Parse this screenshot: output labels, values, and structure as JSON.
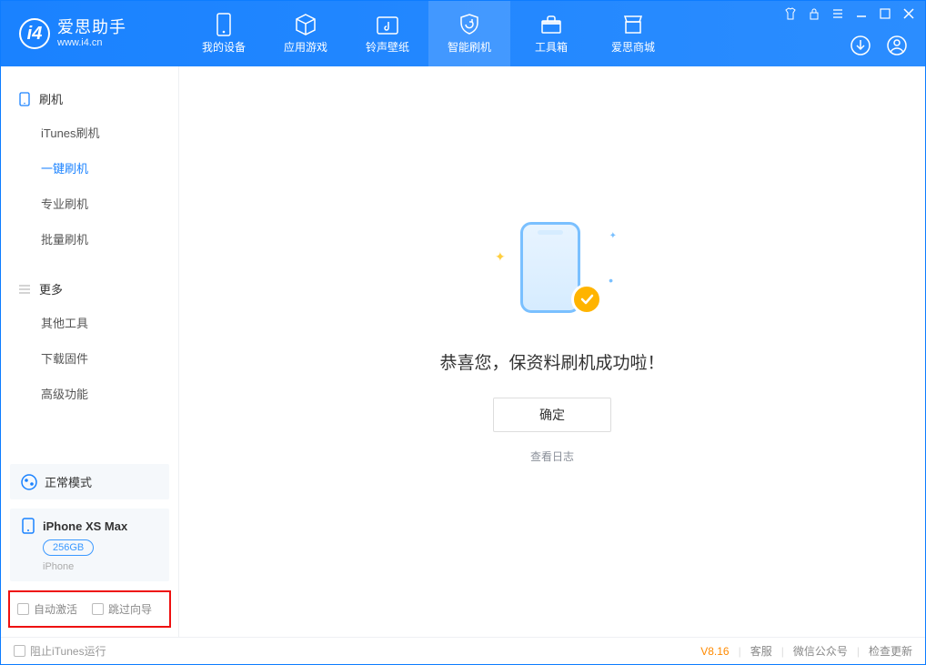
{
  "app": {
    "name": "爱思助手",
    "url": "www.i4.cn"
  },
  "nav": {
    "items": [
      {
        "label": "我的设备"
      },
      {
        "label": "应用游戏"
      },
      {
        "label": "铃声壁纸"
      },
      {
        "label": "智能刷机"
      },
      {
        "label": "工具箱"
      },
      {
        "label": "爱思商城"
      }
    ]
  },
  "sidebar": {
    "group1_title": "刷机",
    "group1_items": [
      "iTunes刷机",
      "一键刷机",
      "专业刷机",
      "批量刷机"
    ],
    "group2_title": "更多",
    "group2_items": [
      "其他工具",
      "下载固件",
      "高级功能"
    ]
  },
  "status": {
    "mode": "正常模式"
  },
  "device": {
    "name": "iPhone XS Max",
    "capacity": "256GB",
    "type": "iPhone"
  },
  "checks": {
    "auto_activate": "自动激活",
    "skip_guide": "跳过向导"
  },
  "main": {
    "success_text": "恭喜您，保资料刷机成功啦！",
    "ok_button": "确定",
    "view_log": "查看日志"
  },
  "footer": {
    "block_itunes": "阻止iTunes运行",
    "version": "V8.16",
    "support": "客服",
    "wechat": "微信公众号",
    "update": "检查更新"
  }
}
